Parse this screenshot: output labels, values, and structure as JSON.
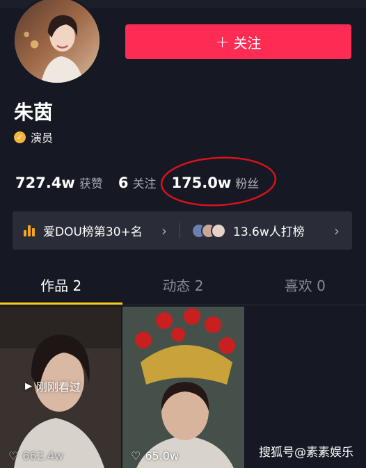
{
  "profile": {
    "name": "朱茵",
    "badge_label": "演员",
    "follow_button": "关注",
    "follow_icon": "plus-icon"
  },
  "stats": [
    {
      "value": "727.4w",
      "label": "获赞"
    },
    {
      "value": "6",
      "label": "关注"
    },
    {
      "value": "175.0w",
      "label": "粉丝"
    }
  ],
  "rank": {
    "left_label": "爱DOU榜第30+名",
    "right_label": "13.6w人打榜"
  },
  "tabs": [
    {
      "label": "作品 2",
      "active": true
    },
    {
      "label": "动态 2",
      "active": false
    },
    {
      "label": "喜欢 0",
      "active": false
    }
  ],
  "videos": [
    {
      "overlay": "刚刚看过",
      "likes": "662.4w"
    },
    {
      "overlay": "",
      "likes": "65.0w"
    }
  ],
  "watermark": "搜狐号@素素娱乐",
  "colors": {
    "background": "#161823",
    "follow": "#fe2c55",
    "badge": "#f5b53d",
    "tab_indicator": "#face15",
    "annotation": "#d7131c"
  }
}
